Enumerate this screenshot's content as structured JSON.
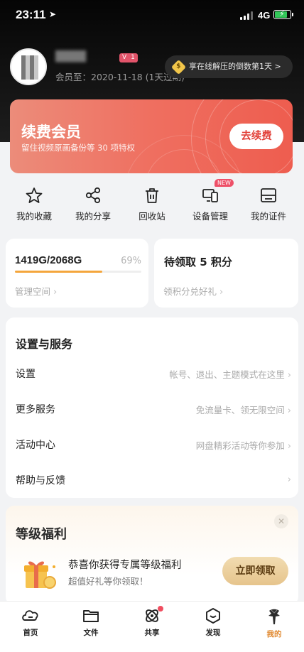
{
  "status_bar": {
    "time": "23:11",
    "network": "4G"
  },
  "profile": {
    "vip_level": "1",
    "expire_text": "会员至：2020-11-18 (1天过期)",
    "promo_text": "享在线解压的倒数第1天 >",
    "promo_badge": "$"
  },
  "renew": {
    "title": "续费会员",
    "subtitle": "留住视频原画备份等 30 项特权",
    "button": "去续费"
  },
  "quick_actions": [
    {
      "label": "我的收藏",
      "icon": "star-icon"
    },
    {
      "label": "我的分享",
      "icon": "share-icon"
    },
    {
      "label": "回收站",
      "icon": "trash-icon"
    },
    {
      "label": "设备管理",
      "icon": "devices-icon",
      "badge": "NEW"
    },
    {
      "label": "我的证件",
      "icon": "id-card-icon"
    }
  ],
  "storage": {
    "value": "1419G/2068G",
    "percent": "69%",
    "fraction": 0.69,
    "link": "管理空间"
  },
  "points": {
    "title": "待领取 5 积分",
    "link": "领积分兑好礼"
  },
  "settings": {
    "heading": "设置与服务",
    "rows": [
      {
        "label": "设置",
        "hint": "帐号、退出、主题模式在这里"
      },
      {
        "label": "更多服务",
        "hint": "免流量卡、领无限空间"
      },
      {
        "label": "活动中心",
        "hint": "网盘精彩活动等你参加"
      },
      {
        "label": "帮助与反馈",
        "hint": ""
      }
    ]
  },
  "level_benefits": {
    "heading": "等级福利",
    "message": "恭喜你获得专属等级福利",
    "sub_message": "超值好礼等你领取！",
    "button": "立即领取"
  },
  "tabs": [
    {
      "label": "首页",
      "icon": "home-icon"
    },
    {
      "label": "文件",
      "icon": "folder-icon"
    },
    {
      "label": "共享",
      "icon": "share-orbit-icon",
      "dot": true
    },
    {
      "label": "发现",
      "icon": "discover-icon"
    },
    {
      "label": "我的",
      "icon": "profile-avatar-icon",
      "active": true
    }
  ],
  "colors": {
    "accent": "#e0872c",
    "renew_red": "#ee5d4f",
    "badge_pink": "#ee5068",
    "progress": "#f4a63c"
  }
}
